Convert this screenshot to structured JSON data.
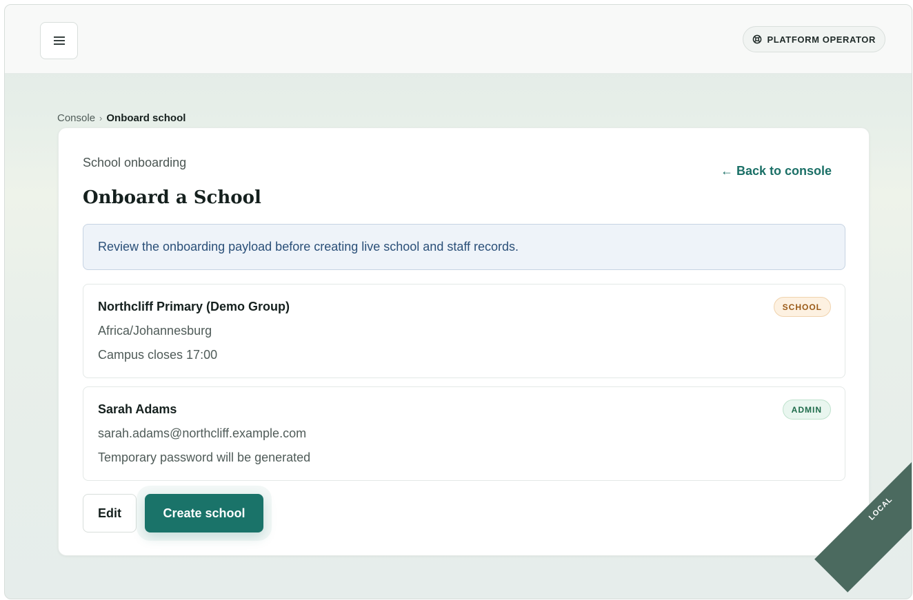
{
  "header": {
    "menu_icon": "hamburger-menu-icon",
    "operator_icon": "lifebuoy-icon",
    "operator_label": "PLATFORM OPERATOR"
  },
  "breadcrumb": {
    "root": "Console",
    "separator": "›",
    "current": "Onboard school"
  },
  "card": {
    "eyebrow": "School onboarding",
    "back_link": "← Back to console",
    "title": "Onboard a School",
    "notice": "Review the onboarding payload before creating live school and staff records."
  },
  "records": {
    "school": {
      "name": "Northcliff Primary (Demo Group)",
      "line1": "Africa/Johannesburg",
      "line2": "Campus closes 17:00",
      "badge": "SCHOOL"
    },
    "admin": {
      "name": "Sarah Adams",
      "line1": "sarah.adams@northcliff.example.com",
      "line2": "Temporary password will be generated",
      "badge": "ADMIN"
    }
  },
  "actions": {
    "edit_label": "Edit",
    "create_label": "Create school"
  },
  "environment": {
    "label": "LOCAL"
  },
  "colors": {
    "accent": "#1a7369",
    "school_badge": "#9a5a17",
    "admin_badge": "#1e6b4a",
    "notice_text": "#2a4f78",
    "ribbon": "#4b6a5f"
  }
}
